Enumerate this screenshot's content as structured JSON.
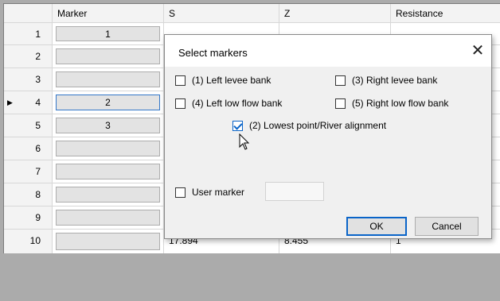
{
  "grid": {
    "headers": [
      "",
      "Marker",
      "S",
      "Z",
      "Resistance"
    ],
    "current_row": 4,
    "rows": [
      {
        "num": "1",
        "marker": "1"
      },
      {
        "num": "2",
        "marker": ""
      },
      {
        "num": "3",
        "marker": ""
      },
      {
        "num": "4",
        "marker": "2"
      },
      {
        "num": "5",
        "marker": "3"
      },
      {
        "num": "6",
        "marker": ""
      },
      {
        "num": "7",
        "marker": ""
      },
      {
        "num": "8",
        "marker": ""
      },
      {
        "num": "9",
        "marker": ""
      },
      {
        "num": "10",
        "marker": "",
        "s": "17.894",
        "z": "8.455",
        "resistance": "1"
      }
    ]
  },
  "dialog": {
    "title": "Select markers",
    "close_icon": "close-icon",
    "checkboxes": {
      "left_levee": {
        "label": "(1) Left levee bank",
        "checked": false
      },
      "right_levee": {
        "label": "(3) Right levee bank",
        "checked": false
      },
      "left_low_flow": {
        "label": "(4) Left low flow bank",
        "checked": false
      },
      "right_low_flow": {
        "label": "(5) Right low flow bank",
        "checked": false
      },
      "lowest_point": {
        "label": "(2) Lowest point/River alignment",
        "checked": true
      },
      "user_marker": {
        "label": "User marker",
        "checked": false
      }
    },
    "user_marker_value": "",
    "ok_label": "OK",
    "cancel_label": "Cancel"
  },
  "colors": {
    "accent": "#0a64c8",
    "grid_background": "#ababab"
  }
}
